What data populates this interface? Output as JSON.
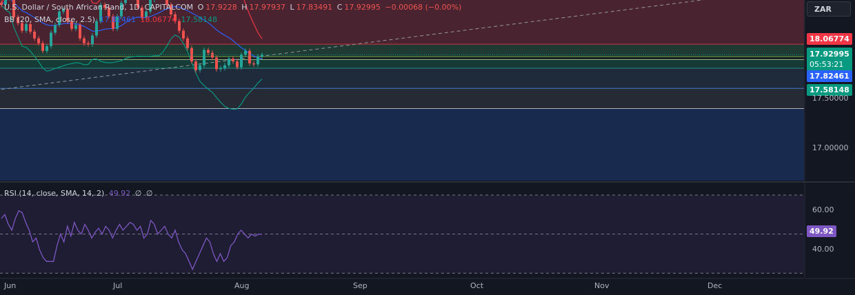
{
  "chart_data": [
    {
      "type": "candlestick",
      "title": "U.S. Dollar / South African Rand, 1D, CAPITALCOM",
      "symbol_currency": "ZAR",
      "ohlc": {
        "open_label": "O",
        "open": "17.9228",
        "high_label": "H",
        "high": "17.97937",
        "low_label": "L",
        "low": "17.83491",
        "close_label": "C",
        "close": "17.92995",
        "change": "−0.00068 (−0.00%)"
      },
      "price_axis_ticks": [
        "17.50000",
        "17.00000"
      ],
      "price_tags": {
        "bb_upper": "18.06774",
        "last": "17.92995",
        "countdown": "05:53:21",
        "bb_basis": "17.82461",
        "bb_lower": "17.58148"
      },
      "x_labels": [
        "Jun",
        "Jul",
        "Aug",
        "Sep",
        "Oct",
        "Nov",
        "Dec"
      ],
      "closes": [
        18.45,
        18.52,
        18.6,
        18.32,
        18.26,
        18.18,
        18.25,
        18.17,
        18.1,
        18.05,
        17.97,
        18.02,
        18.16,
        18.24,
        18.38,
        18.4,
        18.28,
        18.2,
        18.24,
        18.1,
        18.05,
        18.04,
        18.13,
        18.28,
        18.45,
        18.42,
        18.33,
        18.2,
        18.33,
        18.47,
        18.55,
        18.6,
        18.55,
        18.42,
        18.32,
        18.38,
        18.5,
        18.55,
        18.62,
        18.58,
        18.45,
        18.35,
        18.28,
        18.18,
        18.1,
        18.0,
        17.86,
        17.77,
        17.82,
        17.98,
        17.95,
        17.9,
        17.78,
        17.79,
        17.82,
        17.89,
        17.86,
        17.8,
        17.93,
        17.97,
        17.84,
        17.83,
        17.91,
        17.93
      ],
      "indicator_bb": {
        "label": "BB (20, SMA, close, 2.5)",
        "basis": "17.82461",
        "upper": "18.06774",
        "lower": "17.58148"
      },
      "horizontal_levels": [
        18.04,
        17.91,
        17.88,
        17.79,
        17.58,
        17.37
      ],
      "zones": [
        {
          "from": 18.04,
          "to": 18.6,
          "color": "#4a2330"
        },
        {
          "from": 17.91,
          "to": 18.04,
          "color": "#1f3a32"
        },
        {
          "from": 17.79,
          "to": 17.88,
          "color": "#163a36"
        },
        {
          "from": 17.58,
          "to": 17.79,
          "color": "#1f2a3a"
        },
        {
          "from": 17.37,
          "to": 17.58,
          "color": "#262a35"
        },
        {
          "from": 16.6,
          "to": 17.37,
          "color": "#192a4f"
        }
      ],
      "price_range": [
        16.62,
        18.5
      ],
      "trendline": {
        "from": {
          "index": 0,
          "price": 17.57
        },
        "to": {
          "index": 173,
          "price": 18.52
        }
      }
    },
    {
      "type": "line",
      "title": "RSI (14, close, SMA, 14, 2)",
      "value": "49.92",
      "extra": [
        "∅",
        "∅"
      ],
      "y_ticks": [
        "60.00",
        "40.00"
      ],
      "levels": [
        70,
        50,
        30
      ],
      "ylim": [
        28,
        76
      ],
      "values": [
        58,
        60,
        55,
        52,
        58,
        62,
        61,
        56,
        52,
        46,
        48,
        42,
        38,
        36,
        36,
        36,
        44,
        50,
        46,
        54,
        49,
        56,
        52,
        50,
        55,
        52,
        48,
        51,
        53,
        50,
        54,
        52,
        48,
        52,
        55,
        52,
        54,
        56,
        55,
        52,
        54,
        48,
        50,
        57,
        55,
        50,
        52,
        54,
        50,
        48,
        52,
        46,
        42,
        40,
        36,
        32,
        36,
        40,
        44,
        48,
        46,
        40,
        36,
        40,
        36,
        38,
        44,
        46,
        50,
        52,
        50,
        48,
        50,
        49,
        50,
        50
      ]
    }
  ],
  "toolbar": {}
}
